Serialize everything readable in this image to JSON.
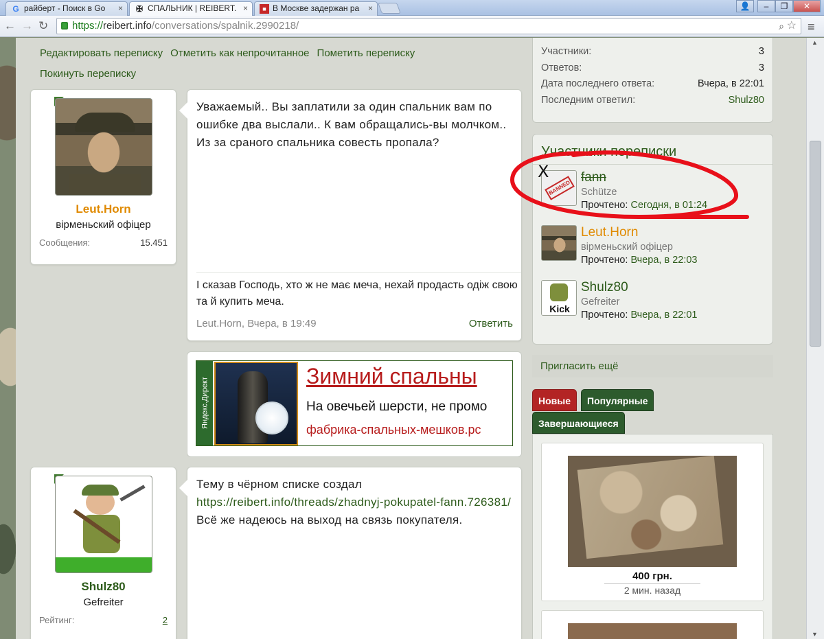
{
  "browser": {
    "tabs": [
      {
        "icon": "google-icon",
        "label": "райберт - Поиск в Go",
        "color": "#4285f4"
      },
      {
        "icon": "iron-cross-icon",
        "label": "СПАЛЬНИК | REIBERT.",
        "active": true
      },
      {
        "icon": "news-icon",
        "label": "В Москве задержан ра"
      }
    ],
    "address": {
      "scheme": "https://",
      "host": "reibert.info",
      "path": "/conversations/spalnik.2990218/"
    }
  },
  "actions": [
    "Редактировать переписку",
    "Отметить как непрочитанное",
    "Пометить переписку",
    "Покинуть переписку"
  ],
  "posts": [
    {
      "author": "Leut.Horn",
      "author_color": "#e08a00",
      "title": "вірменьский офіцер",
      "stat_label": "Сообщения:",
      "stat_value": "15.451",
      "text": "Уважаемый.. Вы заплатили за один спальник вам по ошибке два выслали.. К вам обращались-вы молчком.. Из за сраного спальника совесть пропала?",
      "signature": "І сказав Господь, хто ж не має меча, нехай продасть одіж свою та й купить меча.",
      "meta": "Leut.Horn, Вчера, в 19:49",
      "reply": "Ответить"
    },
    {
      "author": "Shulz80",
      "author_color": "#2d5b1b",
      "title": "Gefreiter",
      "stat_label": "Рейтинг:",
      "stat_value": "2",
      "text_before": "Тему в чёрном списке создал",
      "link": "https://reibert.info/threads/zhadnyj-pokupatel-fann.726381/",
      "text_after": "Всё же надеюсь на выход на связь покупателя."
    }
  ],
  "ad": {
    "label": "Яндекс.Директ",
    "title": "Зимний спальны",
    "desc": "На овечьей шерсти, не промо",
    "url": "фабрика-спальных-мешков.рс"
  },
  "sidebar": {
    "stats": [
      {
        "label": "Участники:",
        "value": "3"
      },
      {
        "label": "Ответов:",
        "value": "3"
      },
      {
        "label": "Дата последнего ответа:",
        "value": "Вчера, в 22:01"
      },
      {
        "label": "Последним ответил:",
        "value": "Shulz80",
        "link": true
      }
    ],
    "participants_title": "Участники переписки",
    "read_label": "Прочтено:",
    "participants": [
      {
        "name": "fann",
        "title": "Schütze",
        "read": "Сегодня, в 01:24",
        "badge": "BANNED"
      },
      {
        "name": "Leut.Horn",
        "title": "вірменьский офіцер",
        "read": "Вчера, в 22:03",
        "name_color": "#e08a00"
      },
      {
        "name": "Shulz80",
        "title": "Gefreiter",
        "read": "Вчера, в 22:01",
        "badge": "Kick"
      }
    ],
    "invite": "Пригласить ещё",
    "tabs": [
      "Новые",
      "Популярные",
      "Завершающиеся"
    ],
    "lots": [
      {
        "price": "400 грн.",
        "time": "2 мин. назад"
      }
    ]
  },
  "annotation": {
    "x_mark": "X",
    "color": "#e8101a"
  }
}
